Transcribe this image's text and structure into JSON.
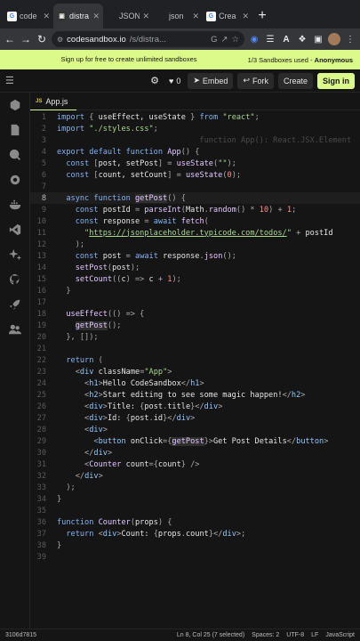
{
  "browser": {
    "tabs": [
      {
        "title": "code",
        "favicon": "G",
        "active": false
      },
      {
        "title": "distra",
        "favicon": "▣",
        "active": true
      },
      {
        "title": "JSON",
        "favicon": "",
        "active": false
      },
      {
        "title": "json",
        "favicon": "",
        "active": false
      },
      {
        "title": "Crea",
        "favicon": "G",
        "active": false
      }
    ],
    "new_tab": "+",
    "url_host": "codesandbox.io",
    "url_path": "/s/distra..."
  },
  "banner": {
    "message": "Sign up for free to create unlimited sandboxes",
    "usage": "1/3 Sandboxes used",
    "visibility": "Anonymous"
  },
  "header": {
    "likes": "0",
    "embed_label": "Embed",
    "fork_label": "Fork",
    "create_label": "Create",
    "signin_label": "Sign in"
  },
  "editor": {
    "tab_label": "App.js",
    "tab_icon_text": "JS"
  },
  "code_lines": [
    {
      "n": "1",
      "html": "<span class='k'>import</span> <span class='p'>{ </span><span class='v'>useEffect, useState</span><span class='p'> }</span> <span class='k'>from</span> <span class='s'>\"react\"</span><span class='p'>;</span>"
    },
    {
      "n": "2",
      "html": "<span class='k'>import</span> <span class='s'>\"./styles.css\"</span><span class='p'>;</span>"
    },
    {
      "n": "3",
      "html": "                               <span class='hint'>function App(): React.JSX.Element</span>"
    },
    {
      "n": "4",
      "html": "<span class='k'>export default function</span> <span class='f'>App</span><span class='p'>() {</span>"
    },
    {
      "n": "5",
      "html": "  <span class='k'>const</span> <span class='p'>[</span><span class='v'>post, setPost</span><span class='p'>] =</span> <span class='f'>useState</span><span class='p'>(</span><span class='s'>\"\"</span><span class='p'>);</span>"
    },
    {
      "n": "6",
      "html": "  <span class='k'>const</span> <span class='p'>[</span><span class='v'>count, setCount</span><span class='p'>] =</span> <span class='f'>useState</span><span class='p'>(</span><span class='n'>0</span><span class='p'>);</span>"
    },
    {
      "n": "7",
      "html": ""
    },
    {
      "n": "8",
      "html": "  <span class='k'>async function</span> <span class='f hl'>getPost</span><span class='p'>() {</span>"
    },
    {
      "n": "9",
      "html": "    <span class='k'>const</span> <span class='v'>postId</span> <span class='p'>=</span> <span class='f'>parseInt</span><span class='p'>(</span><span class='v'>Math</span><span class='p'>.</span><span class='f'>random</span><span class='p'>() *</span> <span class='n'>10</span><span class='p'>) +</span> <span class='n'>1</span><span class='p'>;</span>"
    },
    {
      "n": "10",
      "html": "    <span class='k'>const</span> <span class='v'>response</span> <span class='p'>=</span> <span class='k'>await</span> <span class='f'>fetch</span><span class='p'>(</span>"
    },
    {
      "n": "11",
      "html": "      <span class='s'>\"</span><span class='u'>https://jsonplaceholder.typicode.com/todos/</span><span class='s'>\"</span> <span class='p'>+</span> <span class='v'>postId</span>"
    },
    {
      "n": "12",
      "html": "    <span class='p'>);</span>"
    },
    {
      "n": "13",
      "html": "    <span class='k'>const</span> <span class='v'>post</span> <span class='p'>=</span> <span class='k'>await</span> <span class='v'>response</span><span class='p'>.</span><span class='f'>json</span><span class='p'>();</span>"
    },
    {
      "n": "14",
      "html": "    <span class='f'>setPost</span><span class='p'>(</span><span class='v'>post</span><span class='p'>);</span>"
    },
    {
      "n": "15",
      "html": "    <span class='f'>setCount</span><span class='p'>((</span><span class='v'>c</span><span class='p'>) =></span> <span class='v'>c</span> <span class='p'>+</span> <span class='n'>1</span><span class='p'>);</span>"
    },
    {
      "n": "16",
      "html": "  <span class='p'>}</span>"
    },
    {
      "n": "17",
      "html": ""
    },
    {
      "n": "18",
      "html": "  <span class='f'>useEffect</span><span class='p'>(() => {</span>"
    },
    {
      "n": "19",
      "html": "    <span class='f hl'>getPost</span><span class='p'>();</span>"
    },
    {
      "n": "20",
      "html": "  <span class='p'>}, []);</span>"
    },
    {
      "n": "21",
      "html": ""
    },
    {
      "n": "22",
      "html": "  <span class='k'>return</span> <span class='p'>(</span>"
    },
    {
      "n": "23",
      "html": "    <span class='p'>&lt;</span><span class='t'>div</span> <span class='v'>className</span><span class='p'>=</span><span class='s'>\"App\"</span><span class='p'>&gt;</span>"
    },
    {
      "n": "24",
      "html": "      <span class='p'>&lt;</span><span class='t'>h1</span><span class='p'>&gt;</span><span class='v'>Hello CodeSandbox</span><span class='p'>&lt;/</span><span class='t'>h1</span><span class='p'>&gt;</span>"
    },
    {
      "n": "25",
      "html": "      <span class='p'>&lt;</span><span class='t'>h2</span><span class='p'>&gt;</span><span class='v'>Start editing to see some magic happen!</span><span class='p'>&lt;/</span><span class='t'>h2</span><span class='p'>&gt;</span>"
    },
    {
      "n": "26",
      "html": "      <span class='p'>&lt;</span><span class='t'>div</span><span class='p'>&gt;</span><span class='v'>Title: </span><span class='p'>{</span><span class='v'>post</span><span class='p'>.</span><span class='v'>title</span><span class='p'>}&lt;/</span><span class='t'>div</span><span class='p'>&gt;</span>"
    },
    {
      "n": "27",
      "html": "      <span class='p'>&lt;</span><span class='t'>div</span><span class='p'>&gt;</span><span class='v'>Id: </span><span class='p'>{</span><span class='v'>post</span><span class='p'>.</span><span class='v'>id</span><span class='p'>}&lt;/</span><span class='t'>div</span><span class='p'>&gt;</span>"
    },
    {
      "n": "28",
      "html": "      <span class='p'>&lt;</span><span class='t'>div</span><span class='p'>&gt;</span>"
    },
    {
      "n": "29",
      "html": "        <span class='p'>&lt;</span><span class='t'>button</span> <span class='v'>onClick</span><span class='p'>={</span><span class='f hl'>getPost</span><span class='p'>}&gt;</span><span class='v'>Get Post Details</span><span class='p'>&lt;/</span><span class='t'>button</span><span class='p'>&gt;</span>"
    },
    {
      "n": "30",
      "html": "      <span class='p'>&lt;/</span><span class='t'>div</span><span class='p'>&gt;</span>"
    },
    {
      "n": "31",
      "html": "      <span class='p'>&lt;</span><span class='f'>Counter</span> <span class='v'>count</span><span class='p'>={</span><span class='v'>count</span><span class='p'>} /&gt;</span>"
    },
    {
      "n": "32",
      "html": "    <span class='p'>&lt;/</span><span class='t'>div</span><span class='p'>&gt;</span>"
    },
    {
      "n": "33",
      "html": "  <span class='p'>);</span>"
    },
    {
      "n": "34",
      "html": "<span class='p'>}</span>"
    },
    {
      "n": "35",
      "html": ""
    },
    {
      "n": "36",
      "html": "<span class='k'>function</span> <span class='f'>Counter</span><span class='p'>(</span><span class='v'>props</span><span class='p'>) {</span>"
    },
    {
      "n": "37",
      "html": "  <span class='k'>return</span> <span class='p'>&lt;</span><span class='t'>div</span><span class='p'>&gt;</span><span class='v'>Count: </span><span class='p'>{</span><span class='v'>props</span><span class='p'>.</span><span class='v'>count</span><span class='p'>}&lt;/</span><span class='t'>div</span><span class='p'>&gt;;</span>"
    },
    {
      "n": "38",
      "html": "<span class='p'>}</span>"
    },
    {
      "n": "39",
      "html": ""
    }
  ],
  "current_line": "8",
  "status": {
    "commit": "3106d7815",
    "position": "Ln 8, Col 25 (7 selected)",
    "spaces": "Spaces: 2",
    "encoding": "UTF-8",
    "eol": "LF",
    "language": "JavaScript"
  },
  "colors": {
    "accent": "#dcfa8a",
    "background": "#151515"
  }
}
